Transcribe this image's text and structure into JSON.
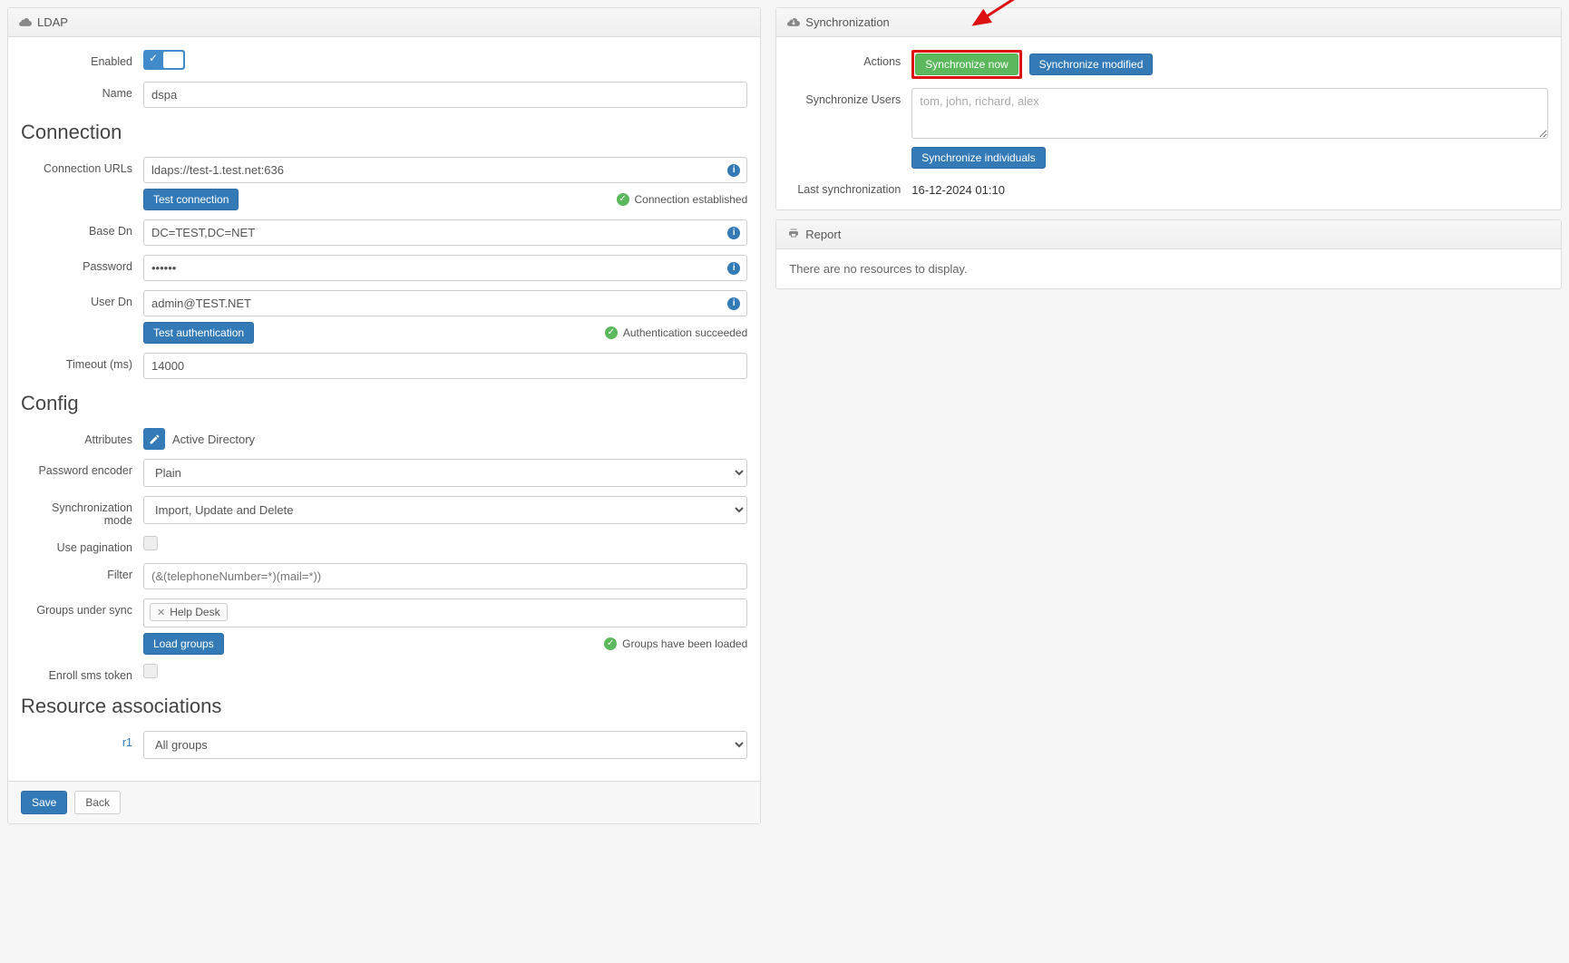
{
  "ldap": {
    "panel_title": "LDAP",
    "enabled_label": "Enabled",
    "enabled": true,
    "name_label": "Name",
    "name_value": "dspa",
    "connection_title": "Connection",
    "connection_urls_label": "Connection URLs",
    "connection_urls_value": "ldaps://test-1.test.net:636",
    "test_connection_btn": "Test connection",
    "connection_status": "Connection established",
    "base_dn_label": "Base Dn",
    "base_dn_value": "DC=TEST,DC=NET",
    "password_label": "Password",
    "password_value": "••••••",
    "user_dn_label": "User Dn",
    "user_dn_value": "admin@TEST.NET",
    "test_auth_btn": "Test authentication",
    "auth_status": "Authentication succeeded",
    "timeout_label": "Timeout (ms)",
    "timeout_value": "14000",
    "config_title": "Config",
    "attributes_label": "Attributes",
    "attributes_text": "Active Directory",
    "password_encoder_label": "Password encoder",
    "password_encoder_value": "Plain",
    "sync_mode_label": "Synchronization mode",
    "sync_mode_value": "Import, Update and Delete",
    "use_pagination_label": "Use pagination",
    "filter_label": "Filter",
    "filter_placeholder": "(&(telephoneNumber=*)(mail=*))",
    "groups_label": "Groups under sync",
    "group_tag": "Help Desk",
    "load_groups_btn": "Load groups",
    "groups_status": "Groups have been loaded",
    "enroll_sms_label": "Enroll sms token",
    "resource_assoc_title": "Resource associations",
    "resource_r1_label": "r1",
    "resource_r1_value": "All groups",
    "save_btn": "Save",
    "back_btn": "Back"
  },
  "sync": {
    "panel_title": "Synchronization",
    "actions_label": "Actions",
    "sync_now_btn": "Synchronize now",
    "sync_modified_btn": "Synchronize modified",
    "sync_users_label": "Synchronize Users",
    "sync_users_placeholder": "tom, john, richard, alex",
    "sync_individuals_btn": "Synchronize individuals",
    "last_sync_label": "Last synchronization",
    "last_sync_value": "16-12-2024 01:10"
  },
  "report": {
    "panel_title": "Report",
    "empty_text": "There are no resources to display."
  }
}
